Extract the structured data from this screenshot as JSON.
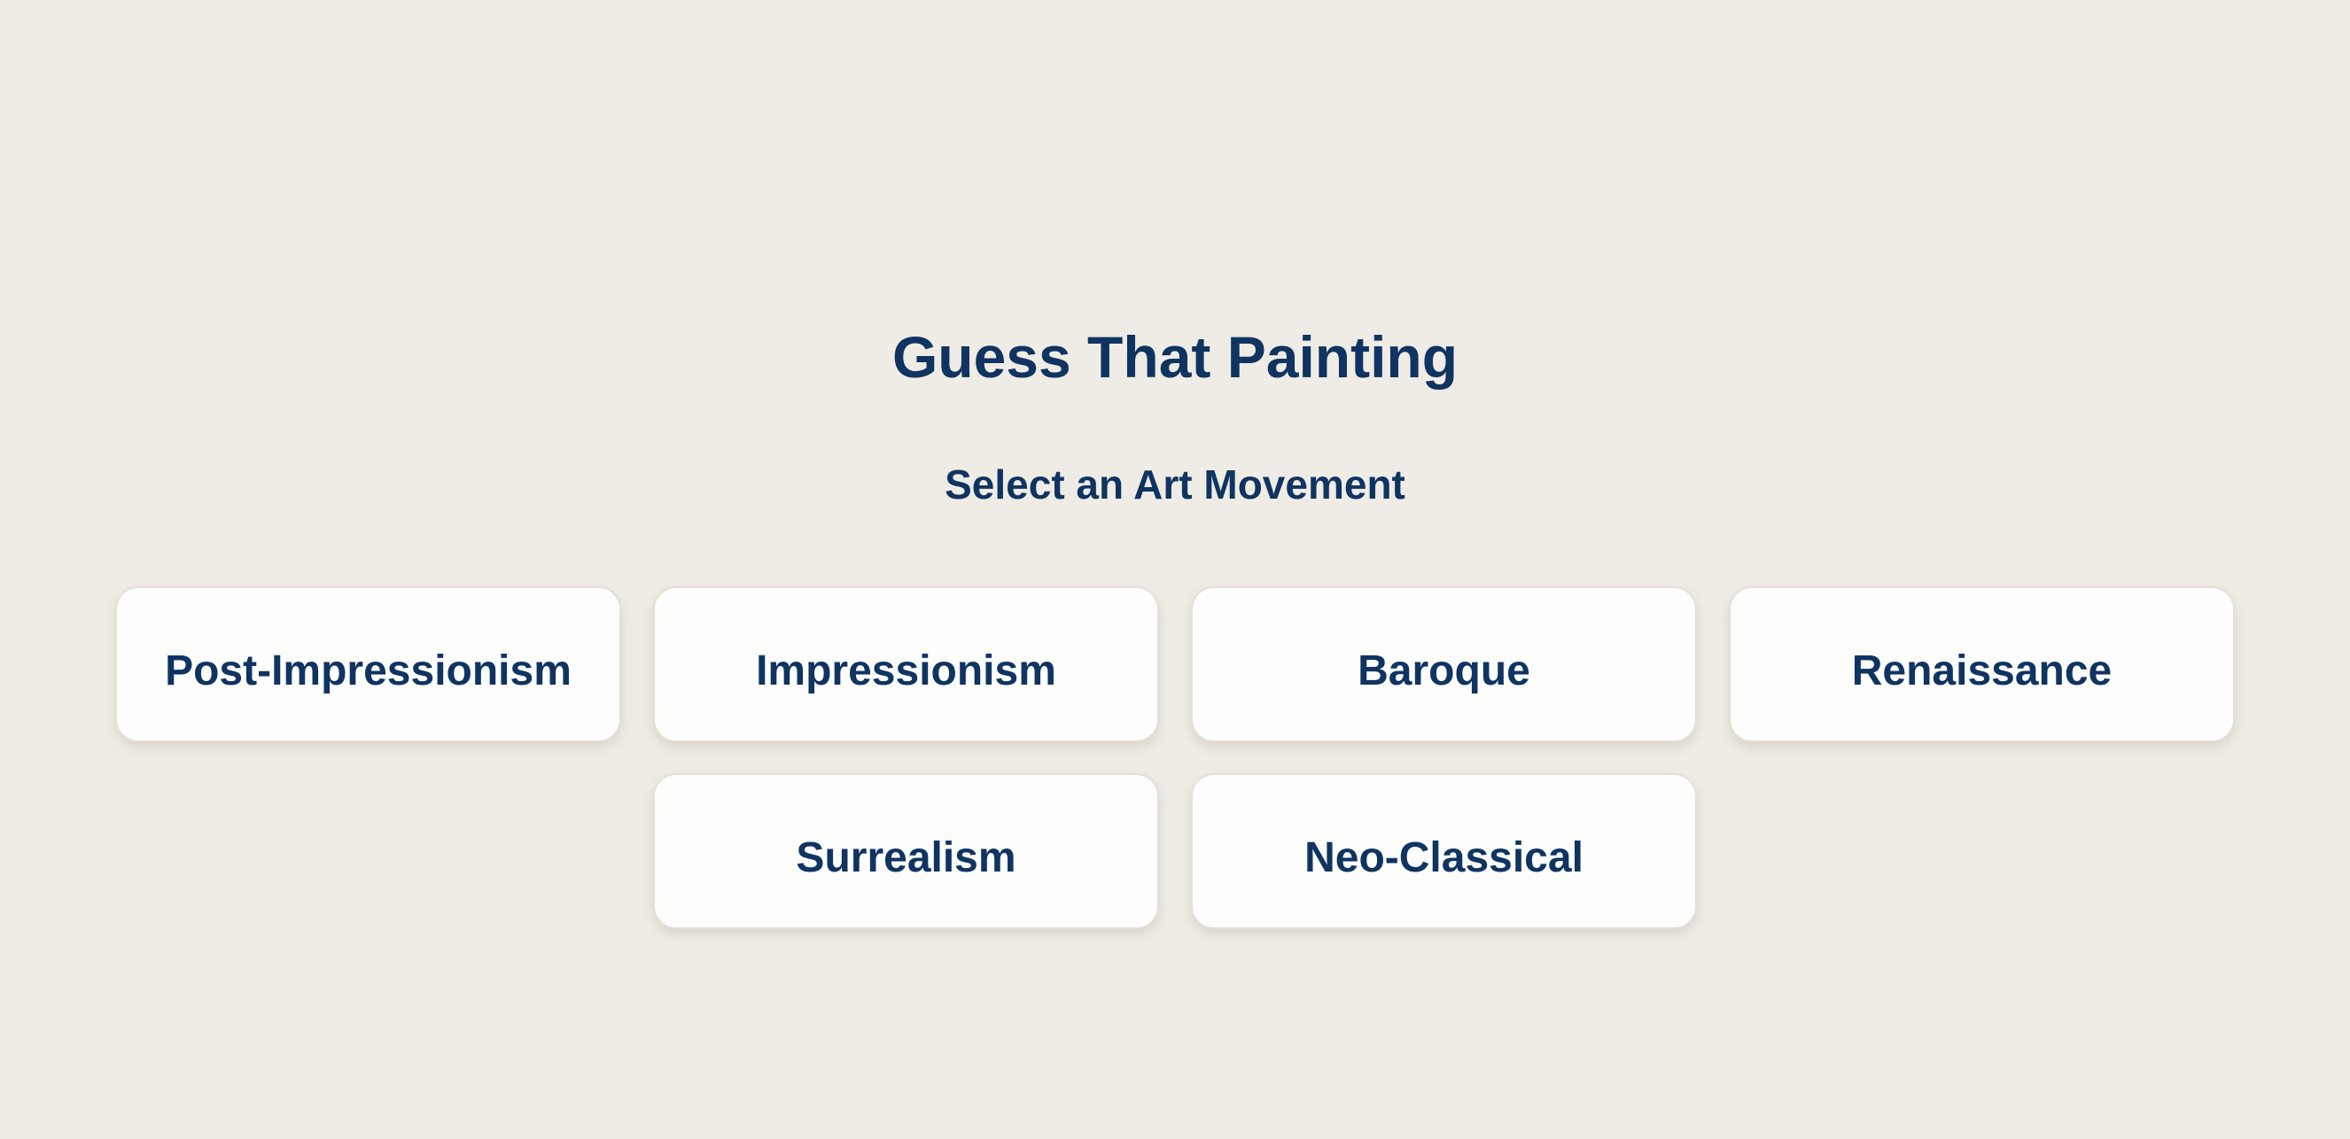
{
  "title": "Guess That Painting",
  "subtitle": "Select an Art Movement",
  "movements": [
    "Post-Impressionism",
    "Impressionism",
    "Baroque",
    "Renaissance",
    "Surrealism",
    "Neo-Classical"
  ],
  "colors": {
    "background": "#efece5",
    "text": "#0f3461",
    "card": "#fdfdfb"
  }
}
